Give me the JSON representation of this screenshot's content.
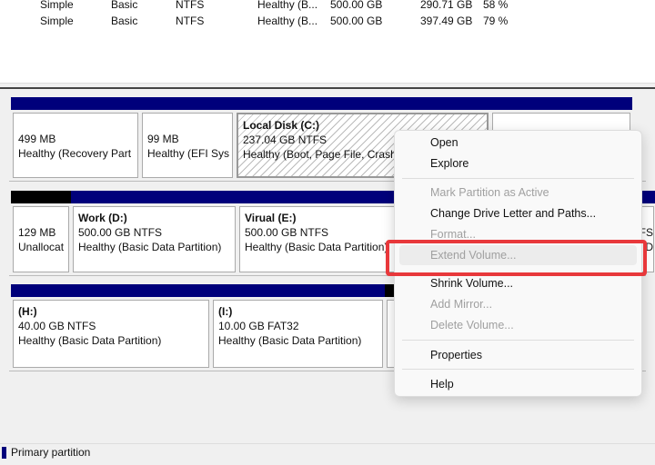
{
  "volume_list": {
    "rows": [
      [
        "Simple",
        "Basic",
        "NTFS",
        "Healthy (B...",
        "500.00 GB",
        "290.71 GB",
        "58 %"
      ],
      [
        "Simple",
        "Basic",
        "NTFS",
        "Healthy (B...",
        "500.00 GB",
        "397.49 GB",
        "79 %"
      ]
    ]
  },
  "disks": [
    {
      "partitions": [
        {
          "name": "",
          "size": "499 MB",
          "status": "Healthy (Recovery Part",
          "type": "primary"
        },
        {
          "name": "",
          "size": "99 MB",
          "status": "Healthy (EFI Sys",
          "type": "primary"
        },
        {
          "name": "Local Disk  (C:)",
          "size": "237.04 GB NTFS",
          "status": "Healthy (Boot, Page File, Crash",
          "type": "primary",
          "selected": true
        },
        {
          "name": "",
          "size": "",
          "status": "",
          "type": "primary"
        }
      ]
    },
    {
      "partitions": [
        {
          "name": "",
          "size": "129 MB",
          "status": "Unallocat",
          "type": "unallocated"
        },
        {
          "name": "Work  (D:)",
          "size": "500.00 GB NTFS",
          "status": "Healthy (Basic Data Partition)",
          "type": "primary"
        },
        {
          "name": "Virual  (E:)",
          "size": "500.00 GB NTFS",
          "status": "Healthy (Basic Data Partition)",
          "type": "primary"
        },
        {
          "name": "",
          "size": "FS",
          "status": "c D",
          "type": "primary"
        }
      ]
    },
    {
      "partitions": [
        {
          "name": " (H:)",
          "size": "40.00 GB NTFS",
          "status": "Healthy (Basic Data Partition)",
          "type": "primary"
        },
        {
          "name": " (I:)",
          "size": "10.00 GB FAT32",
          "status": "Healthy (Basic Data Partition)",
          "type": "primary"
        },
        {
          "name": "",
          "size": "",
          "status": "",
          "type": "unallocated"
        }
      ]
    }
  ],
  "context_menu": {
    "items": [
      {
        "label": "Open",
        "enabled": true
      },
      {
        "label": "Explore",
        "enabled": true
      },
      {
        "label": "Mark Partition as Active",
        "enabled": false
      },
      {
        "label": "Change Drive Letter and Paths...",
        "enabled": true
      },
      {
        "label": "Format...",
        "enabled": false
      },
      {
        "label": "Extend Volume...",
        "enabled": false,
        "highlighted": true
      },
      {
        "label": "Shrink Volume...",
        "enabled": true
      },
      {
        "label": "Add Mirror...",
        "enabled": false
      },
      {
        "label": "Delete Volume...",
        "enabled": false
      },
      {
        "label": "Properties",
        "enabled": true
      },
      {
        "label": "Help",
        "enabled": true
      }
    ]
  },
  "legend": {
    "primary_label": "Primary partition",
    "primary_color": "#00007b"
  },
  "colors": {
    "primary": "#00007b",
    "unallocated": "#000000",
    "highlight": "#e8383b"
  }
}
